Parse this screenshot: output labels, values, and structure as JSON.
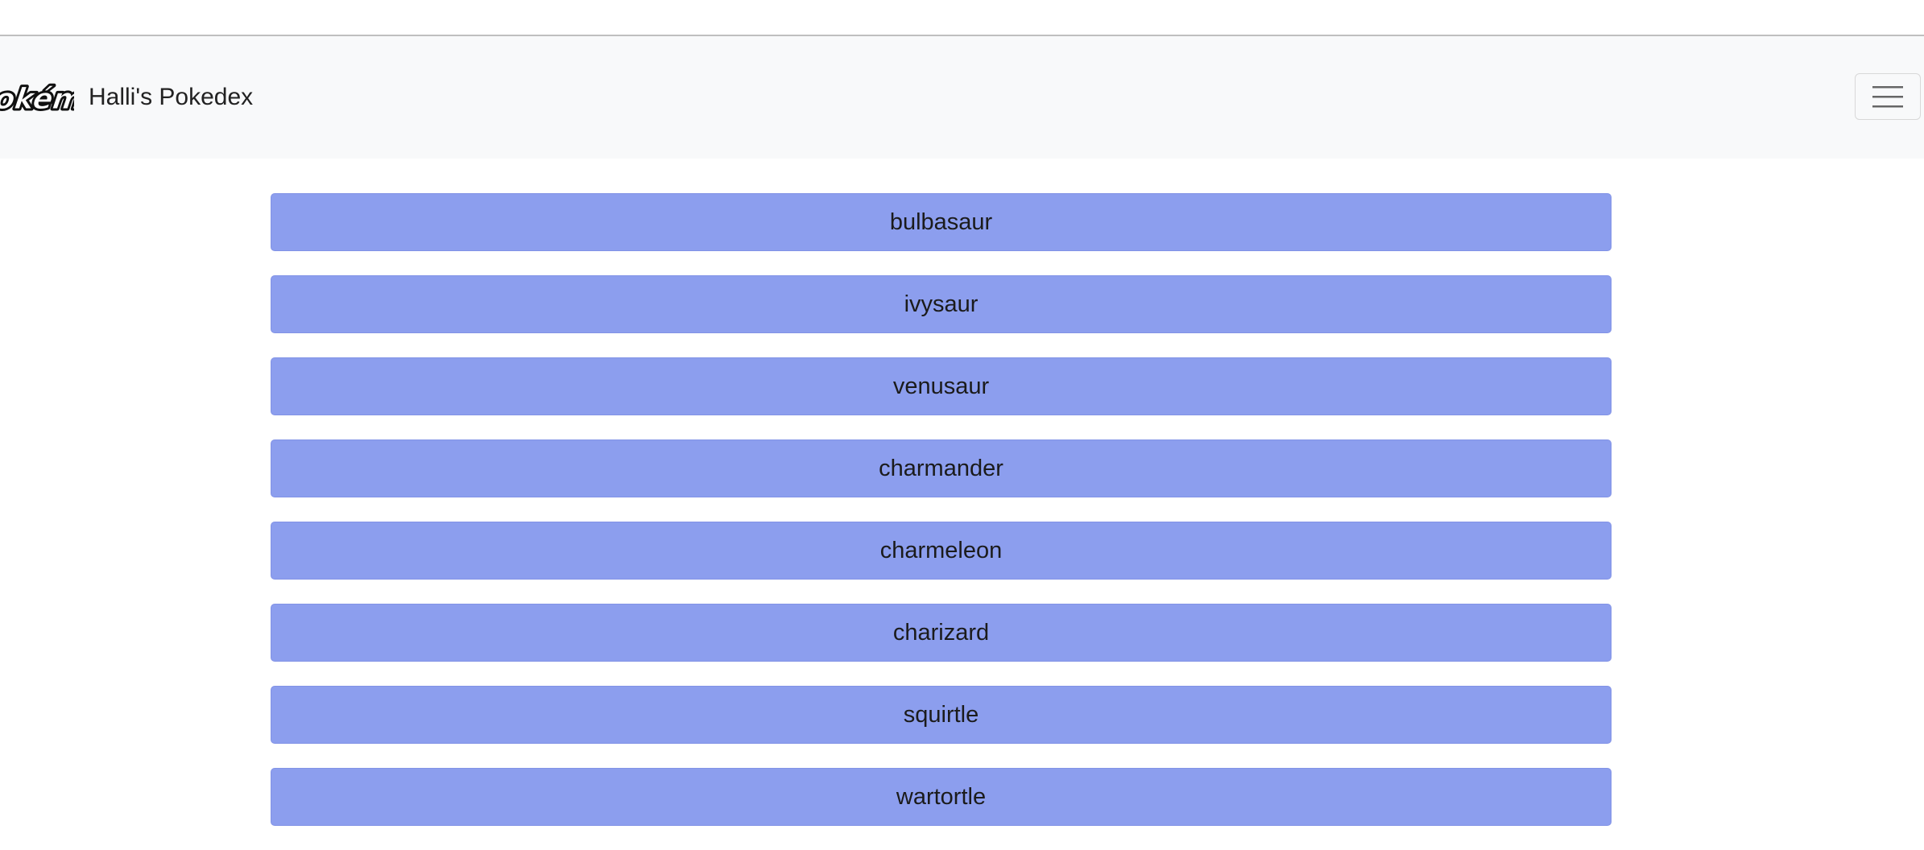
{
  "navbar": {
    "brand_title": "Halli's Pokedex",
    "logo_icon": "pokemon-logo",
    "menu_icon": "hamburger-menu-icon"
  },
  "colors": {
    "navbar_bg": "#f8f9fa",
    "button_bg": "#8c9eee",
    "button_text": "#1b1b1b"
  },
  "pokemon_list": [
    {
      "name": "bulbasaur"
    },
    {
      "name": "ivysaur"
    },
    {
      "name": "venusaur"
    },
    {
      "name": "charmander"
    },
    {
      "name": "charmeleon"
    },
    {
      "name": "charizard"
    },
    {
      "name": "squirtle"
    },
    {
      "name": "wartortle"
    }
  ]
}
